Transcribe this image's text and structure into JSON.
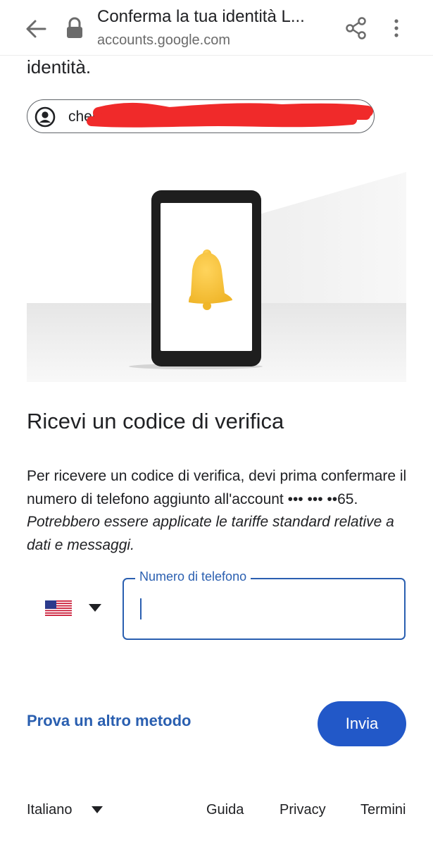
{
  "browser": {
    "title": "Conferma la tua identità L...",
    "url": "accounts.google.com",
    "icons": [
      "back-arrow-icon",
      "lock-icon",
      "share-icon",
      "more-vert-icon"
    ]
  },
  "heading_tail": "identità.",
  "account": {
    "email": "cheru",
    "redacted": true
  },
  "section": {
    "title": "Ricevi un codice di verifica",
    "description": "Per ricevere un codice di verifica, devi prima confermare il numero di telefono aggiunto all'account ••• ••• ••65.",
    "note": "Potrebbero essere applicate le tariffe standard relative a dati e messaggi."
  },
  "phone": {
    "country_flag": "us-flag-icon",
    "label": "Numero di telefono",
    "value": ""
  },
  "actions": {
    "try_another": "Prova un altro metodo",
    "send": "Invia"
  },
  "footer": {
    "language": "Italiano",
    "help": "Guida",
    "privacy": "Privacy",
    "terms": "Termini"
  },
  "colors": {
    "accent": "#2a5fb0",
    "button": "#2258c8",
    "redaction": "#f02a2a",
    "bell": "#f5c63a"
  }
}
